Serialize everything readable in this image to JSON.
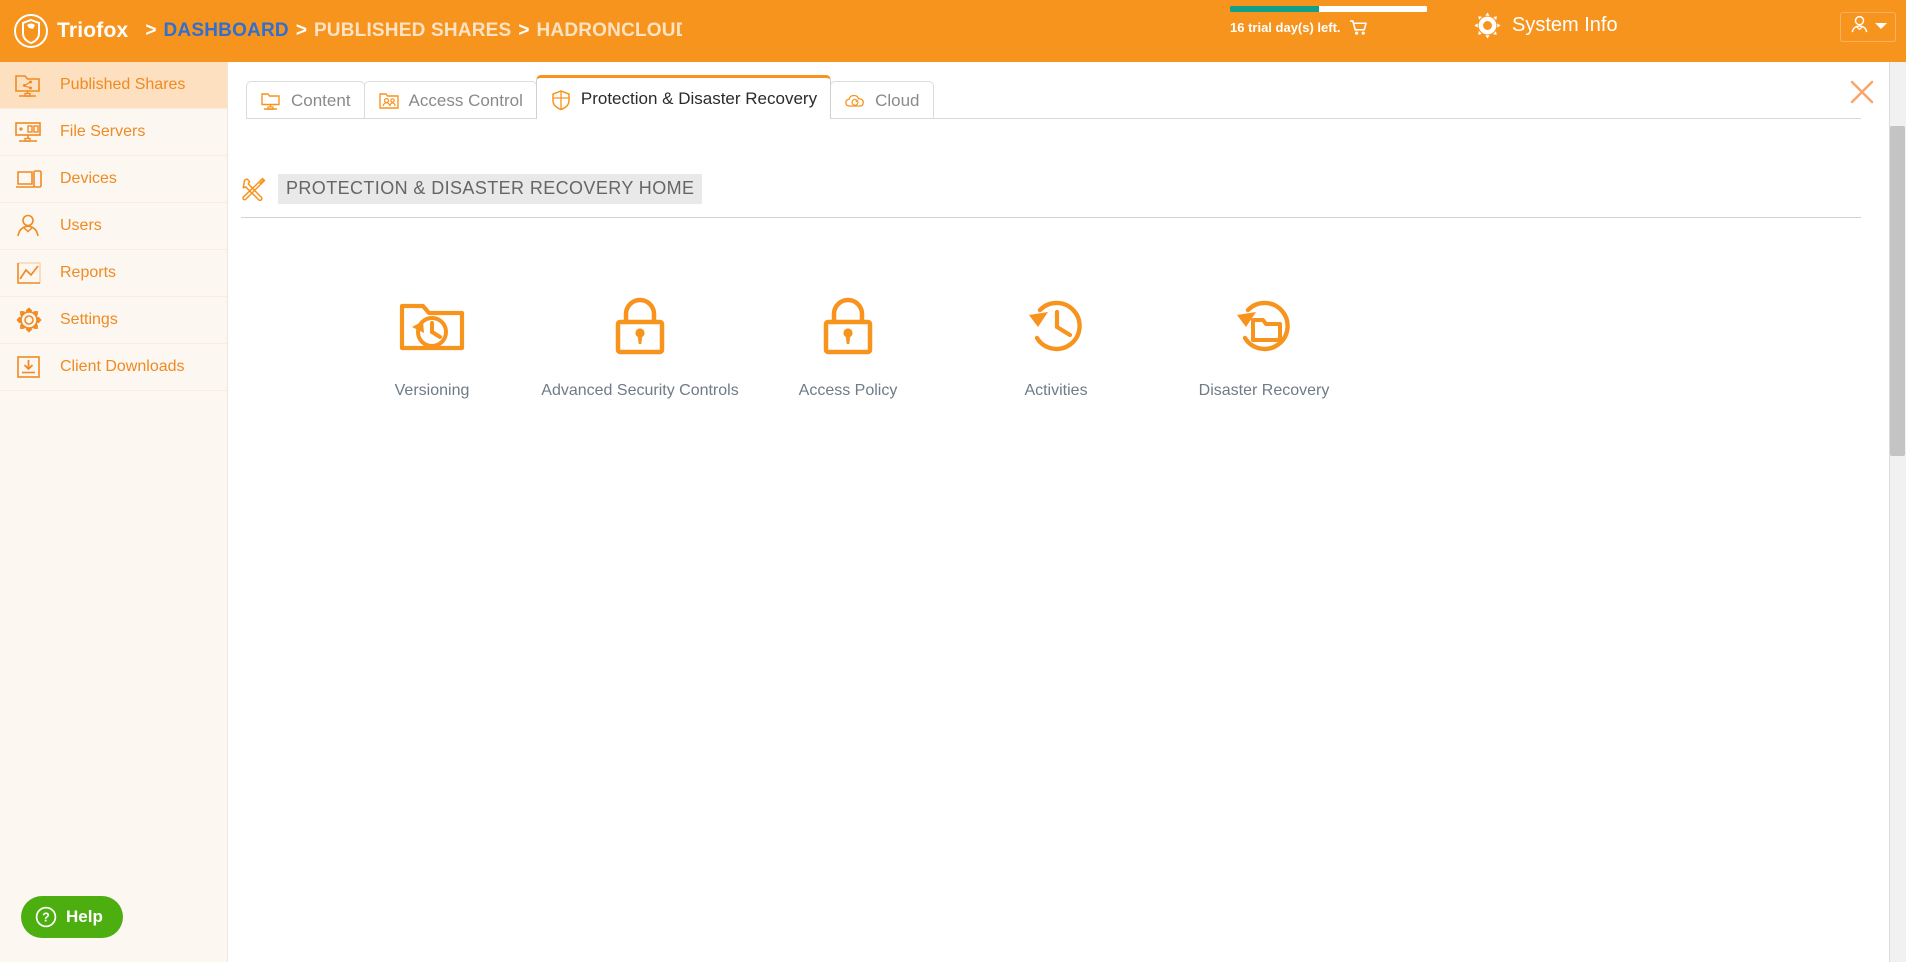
{
  "header": {
    "brand": "Triofox",
    "logo_icon": "shield-logo-icon",
    "breadcrumb": [
      {
        "label": "DASHBOARD",
        "style": "link"
      },
      {
        "label": "PUBLISHED SHARES",
        "style": "plain"
      },
      {
        "label": "HADRONCLOUD-",
        "style": "plain"
      }
    ],
    "separator": ">",
    "trial": {
      "text": "16 trial day(s) left.",
      "percent": 45,
      "bar_fill_color": "#13a08b",
      "bar_track_color": "#ffffff",
      "cart_icon": "shopping-cart-icon"
    },
    "system_info": {
      "label": "System Info",
      "icon": "gear-icon"
    },
    "user_menu": {
      "avatar_icon": "user-avatar-icon",
      "caret_icon": "chevron-down-icon"
    },
    "background_color": "#f7941e"
  },
  "sidebar": {
    "background_color": "#fdf7f2",
    "accent_color": "#f08a22",
    "active_background": "#fce0c0",
    "items": [
      {
        "label": "Published Shares",
        "icon": "shared-folder-icon",
        "active": true
      },
      {
        "label": "File Servers",
        "icon": "server-icon",
        "active": false
      },
      {
        "label": "Devices",
        "icon": "devices-icon",
        "active": false
      },
      {
        "label": "Users",
        "icon": "user-icon",
        "active": false
      },
      {
        "label": "Reports",
        "icon": "chart-icon",
        "active": false
      },
      {
        "label": "Settings",
        "icon": "gear-icon",
        "active": false
      },
      {
        "label": "Client Downloads",
        "icon": "download-box-icon",
        "active": false
      }
    ],
    "help_button": {
      "label": "Help",
      "icon": "question-mark-icon",
      "color": "#4caf0f"
    }
  },
  "content": {
    "close_icon": "close-x-icon",
    "tabs": [
      {
        "label": "Content",
        "icon": "content-folder-icon",
        "active": false
      },
      {
        "label": "Access Control",
        "icon": "access-control-icon",
        "active": false
      },
      {
        "label": "Protection & Disaster Recovery",
        "icon": "shield-icon",
        "active": true
      },
      {
        "label": "Cloud",
        "icon": "cloud-sync-icon",
        "active": false
      }
    ],
    "page_heading": {
      "title": "PROTECTION & DISASTER RECOVERY HOME",
      "icon": "tools-icon"
    },
    "tiles": [
      {
        "label": "Versioning",
        "icon": "folder-history-icon"
      },
      {
        "label": "Advanced Security Controls",
        "icon": "padlock-icon"
      },
      {
        "label": "Access Policy",
        "icon": "padlock-icon"
      },
      {
        "label": "Activities",
        "icon": "clock-history-icon"
      },
      {
        "label": "Disaster Recovery",
        "icon": "folder-restore-icon"
      }
    ]
  }
}
